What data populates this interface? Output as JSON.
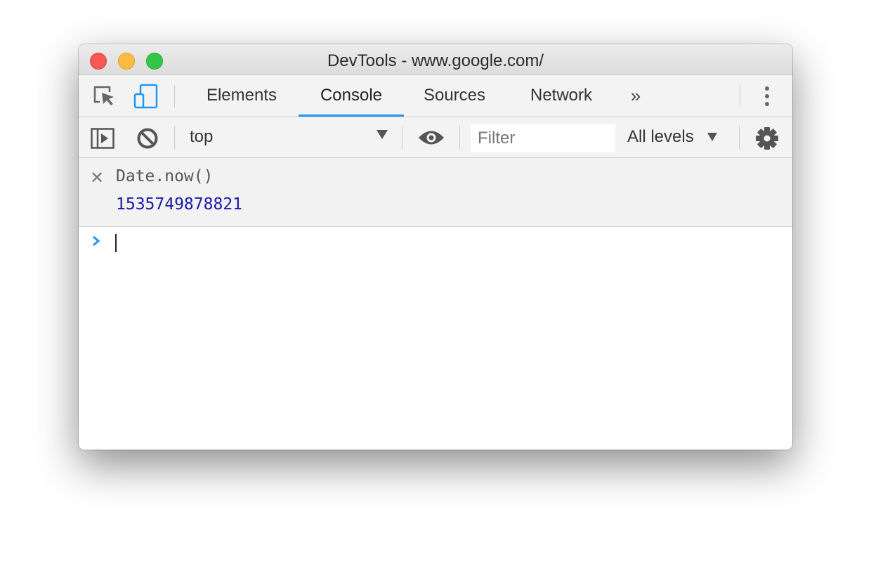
{
  "window": {
    "title": "DevTools - www.google.com/",
    "traffic_lights": [
      "close",
      "minimize",
      "zoom"
    ]
  },
  "tabbar": {
    "icons": [
      "inspect-element-icon",
      "device-toolbar-icon"
    ],
    "tabs": [
      {
        "label": "Elements",
        "active": false
      },
      {
        "label": "Console",
        "active": true
      },
      {
        "label": "Sources",
        "active": false
      },
      {
        "label": "Network",
        "active": false
      }
    ],
    "more_tabs_glyph": "»",
    "menu_icon": "vertical-dots-icon"
  },
  "console_toolbar": {
    "context": "top",
    "filter_placeholder": "Filter",
    "filter_value": "",
    "levels": "All levels"
  },
  "console": {
    "entries": [
      {
        "command": "Date.now()",
        "result": "1535749878821"
      }
    ],
    "prompt_glyph": "›",
    "input_value": ""
  },
  "colors": {
    "accent": "#2196f3",
    "result_number": "#1a1aa6",
    "toolbar_bg": "#f3f3f3"
  }
}
